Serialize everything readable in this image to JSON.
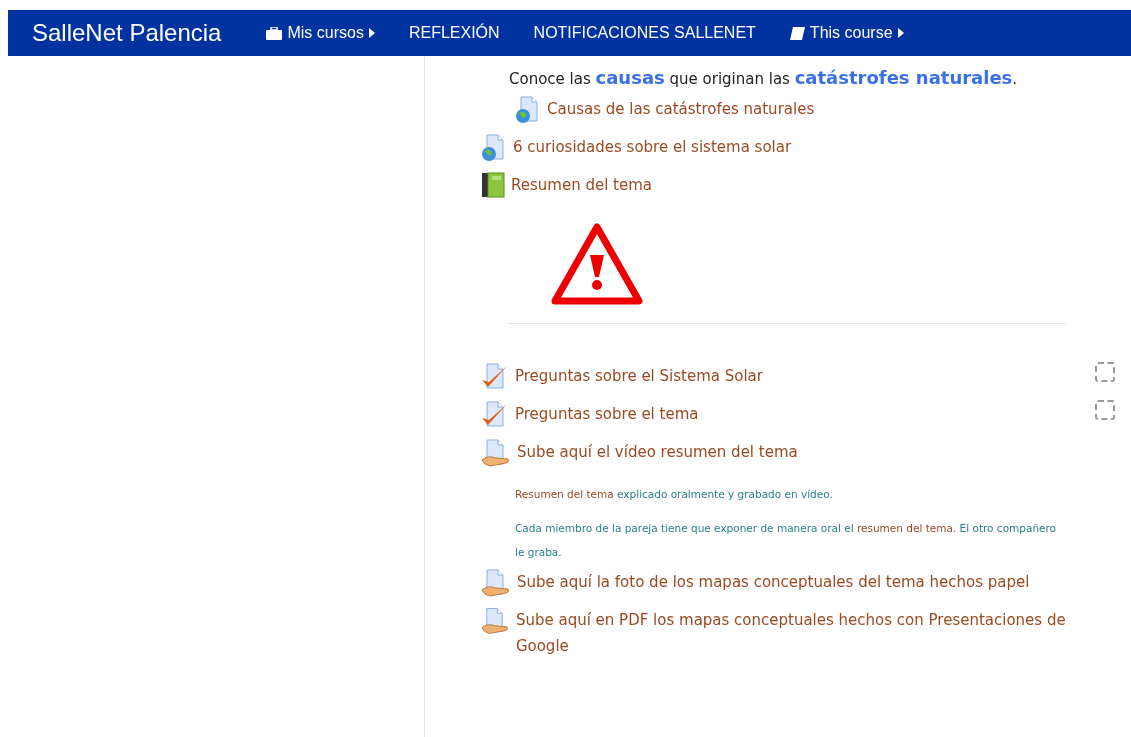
{
  "navbar": {
    "brand": "SalleNet Palencia",
    "menu": [
      {
        "label": "Mis cursos",
        "kind": "courses"
      },
      {
        "label": "REFLEXIÓN",
        "kind": "link"
      },
      {
        "label": "NOTIFICACIONES SALLENET",
        "kind": "link"
      },
      {
        "label": "This course",
        "kind": "course"
      }
    ]
  },
  "activities": [
    {
      "kind": "label",
      "text": "Conoce las **causas** que originan las **catástrofes naturales**.",
      "children": [
        {
          "kind": "url",
          "name": "Causas de las catástrofes naturales"
        }
      ]
    },
    {
      "kind": "url",
      "name": "6 curiosidades sobre el sistema solar"
    },
    {
      "kind": "book",
      "name": "Resumen del tema"
    },
    {
      "kind": "warning"
    },
    {
      "kind": "divider"
    },
    {
      "kind": "quiz",
      "name": "Preguntas sobre el Sistema Solar",
      "completion": {
        "checked": false
      }
    },
    {
      "kind": "quiz",
      "name": "Preguntas sobre el tema",
      "completion": {
        "checked": false
      }
    },
    {
      "kind": "assign",
      "name": "Sube aquí el vídeo resumen del tema",
      "description": [
        [
          {
            "kind": "link",
            "text": "Resumen del tema"
          },
          {
            "kind": "text",
            "text": " explicado oralmente y grabado en vídeo."
          }
        ],
        [
          {
            "kind": "text",
            "text": "Cada miembro de la pareja tiene que exponer de manera oral el "
          },
          {
            "kind": "link",
            "text": "resumen del tema"
          },
          {
            "kind": "text",
            "text": ". El otro compañero le graba."
          }
        ]
      ]
    },
    {
      "kind": "assign",
      "name": "Sube aquí la foto de los mapas conceptuales del tema hechos papel"
    },
    {
      "kind": "assign",
      "name": "Sube aquí en PDF los mapas conceptuales hechos con Presentaciones de Google"
    }
  ]
}
